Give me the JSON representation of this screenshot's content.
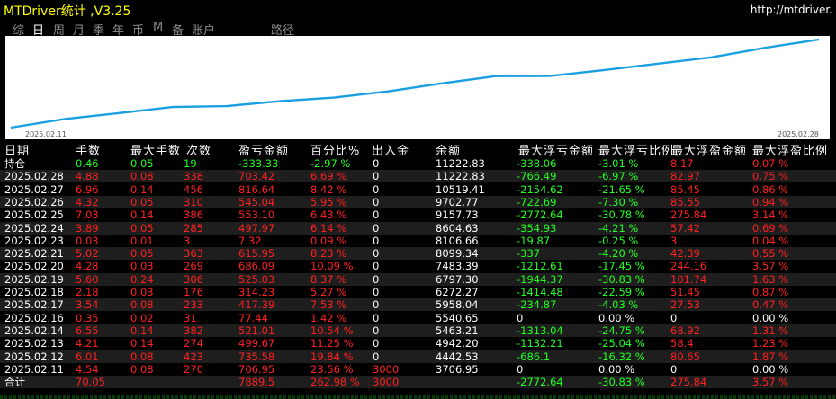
{
  "app": {
    "title": "MTDriver统计 ,V3.25",
    "url": "http://mtdriver."
  },
  "tabs": [
    {
      "label": "综",
      "active": false
    },
    {
      "label": "日",
      "active": true
    },
    {
      "label": "周",
      "active": false
    },
    {
      "label": "月",
      "active": false
    },
    {
      "label": "季",
      "active": false
    },
    {
      "label": "年",
      "active": false
    },
    {
      "label": "币",
      "active": false
    },
    {
      "label": "M",
      "active": false
    },
    {
      "label": "备",
      "active": false
    },
    {
      "label": "账户",
      "active": false
    },
    {
      "label": "路径",
      "active": false
    }
  ],
  "chart_data": {
    "type": "line",
    "x_start_label": "2025.02.11",
    "x_end_label": "2025.02.28",
    "x": [
      "2025.02.11",
      "2025.02.12",
      "2025.02.13",
      "2025.02.14",
      "2025.02.16",
      "2025.02.17",
      "2025.02.18",
      "2025.02.19",
      "2025.02.20",
      "2025.02.21",
      "2025.02.23",
      "2025.02.24",
      "2025.02.25",
      "2025.02.26",
      "2025.02.27",
      "2025.02.28"
    ],
    "values": [
      3706.95,
      4442.53,
      4942.2,
      5463.21,
      5540.65,
      5958.04,
      6272.27,
      6797.3,
      7483.39,
      8099.34,
      8106.66,
      8604.63,
      9157.73,
      9702.77,
      10519.41,
      11222.83
    ],
    "line_color": "#1a9fe0"
  },
  "headers": [
    "日期",
    "手数",
    "最大手数",
    "次数",
    "盈亏金额",
    "百分比%",
    "出入金",
    "余额",
    "最大浮亏金额",
    "最大浮亏比例",
    "最大浮盈金额",
    "最大浮盈比例"
  ],
  "rows": [
    {
      "date": "持仓",
      "lots": "0.46",
      "maxlots": "0.05",
      "count": "19",
      "pnl": "-333.33",
      "pct": "-2.97 %",
      "io": "0",
      "bal": "11222.83",
      "mfl": "-338.06",
      "mflp": "-3.01 %",
      "mfp": "8.17",
      "mfpp": "0.07 %",
      "tone": "green",
      "date_tone": "yellow"
    },
    {
      "date": "2025.02.28",
      "lots": "4.88",
      "maxlots": "0.08",
      "count": "338",
      "pnl": "703.42",
      "pct": "6.69 %",
      "io": "0",
      "bal": "11222.83",
      "mfl": "-766.49",
      "mflp": "-6.97 %",
      "mfp": "82.97",
      "mfpp": "0.75 %",
      "tone": "red"
    },
    {
      "date": "2025.02.27",
      "lots": "6.96",
      "maxlots": "0.14",
      "count": "456",
      "pnl": "816.64",
      "pct": "8.42 %",
      "io": "0",
      "bal": "10519.41",
      "mfl": "-2154.62",
      "mflp": "-21.65 %",
      "mfp": "85.45",
      "mfpp": "0.86 %",
      "tone": "red"
    },
    {
      "date": "2025.02.26",
      "lots": "4.32",
      "maxlots": "0.05",
      "count": "310",
      "pnl": "545.04",
      "pct": "5.95 %",
      "io": "0",
      "bal": "9702.77",
      "mfl": "-722.69",
      "mflp": "-7.30 %",
      "mfp": "85.55",
      "mfpp": "0.94 %",
      "tone": "red"
    },
    {
      "date": "2025.02.25",
      "lots": "7.03",
      "maxlots": "0.14",
      "count": "386",
      "pnl": "553.10",
      "pct": "6.43 %",
      "io": "0",
      "bal": "9157.73",
      "mfl": "-2772.64",
      "mflp": "-30.78 %",
      "mfp": "275.84",
      "mfpp": "3.14 %",
      "tone": "red"
    },
    {
      "date": "2025.02.24",
      "lots": "3.89",
      "maxlots": "0.05",
      "count": "285",
      "pnl": "497.97",
      "pct": "6.14 %",
      "io": "0",
      "bal": "8604.63",
      "mfl": "-354.93",
      "mflp": "-4.21 %",
      "mfp": "57.42",
      "mfpp": "0.69 %",
      "tone": "red"
    },
    {
      "date": "2025.02.23",
      "lots": "0.03",
      "maxlots": "0.01",
      "count": "3",
      "pnl": "7.32",
      "pct": "0.09 %",
      "io": "0",
      "bal": "8106.66",
      "mfl": "-19.87",
      "mflp": "-0.25 %",
      "mfp": "3",
      "mfpp": "0.04 %",
      "tone": "red"
    },
    {
      "date": "2025.02.21",
      "lots": "5.02",
      "maxlots": "0.05",
      "count": "363",
      "pnl": "615.95",
      "pct": "8.23 %",
      "io": "0",
      "bal": "8099.34",
      "mfl": "-337",
      "mflp": "-4.20 %",
      "mfp": "42.39",
      "mfpp": "0.55 %",
      "tone": "red"
    },
    {
      "date": "2025.02.20",
      "lots": "4.28",
      "maxlots": "0.03",
      "count": "269",
      "pnl": "686.09",
      "pct": "10.09 %",
      "io": "0",
      "bal": "7483.39",
      "mfl": "-1212.61",
      "mflp": "-17.45 %",
      "mfp": "244.16",
      "mfpp": "3.57 %",
      "tone": "red"
    },
    {
      "date": "2025.02.19",
      "lots": "5.60",
      "maxlots": "0.24",
      "count": "306",
      "pnl": "525.03",
      "pct": "8.37 %",
      "io": "0",
      "bal": "6797.30",
      "mfl": "-1944.37",
      "mflp": "-30.83 %",
      "mfp": "101.74",
      "mfpp": "1.63 %",
      "tone": "red"
    },
    {
      "date": "2025.02.18",
      "lots": "2.18",
      "maxlots": "0.03",
      "count": "176",
      "pnl": "314.23",
      "pct": "5.27 %",
      "io": "0",
      "bal": "6272.27",
      "mfl": "-1414.48",
      "mflp": "-22.59 %",
      "mfp": "51.45",
      "mfpp": "0.87 %",
      "tone": "red"
    },
    {
      "date": "2025.02.17",
      "lots": "3.54",
      "maxlots": "0.08",
      "count": "233",
      "pnl": "417.39",
      "pct": "7.53 %",
      "io": "0",
      "bal": "5958.04",
      "mfl": "-234.87",
      "mflp": "-4.03 %",
      "mfp": "27.53",
      "mfpp": "0.47 %",
      "tone": "red"
    },
    {
      "date": "2025.02.16",
      "lots": "0.35",
      "maxlots": "0.02",
      "count": "31",
      "pnl": "77.44",
      "pct": "1.42 %",
      "io": "0",
      "bal": "5540.65",
      "mfl": "0",
      "mflp": "0.00 %",
      "mfp": "0",
      "mfpp": "0.00 %",
      "tone": "red",
      "tail_white": true
    },
    {
      "date": "2025.02.14",
      "lots": "6.55",
      "maxlots": "0.14",
      "count": "382",
      "pnl": "521.01",
      "pct": "10.54 %",
      "io": "0",
      "bal": "5463.21",
      "mfl": "-1313.04",
      "mflp": "-24.75 %",
      "mfp": "68.92",
      "mfpp": "1.31 %",
      "tone": "red"
    },
    {
      "date": "2025.02.13",
      "lots": "4.21",
      "maxlots": "0.14",
      "count": "274",
      "pnl": "499.67",
      "pct": "11.25 %",
      "io": "0",
      "bal": "4942.20",
      "mfl": "-1132.21",
      "mflp": "-25.04 %",
      "mfp": "58.4",
      "mfpp": "1.23 %",
      "tone": "red"
    },
    {
      "date": "2025.02.12",
      "lots": "6.01",
      "maxlots": "0.08",
      "count": "423",
      "pnl": "735.58",
      "pct": "19.84 %",
      "io": "0",
      "bal": "4442.53",
      "mfl": "-686.1",
      "mflp": "-16.32 %",
      "mfp": "80.65",
      "mfpp": "1.87 %",
      "tone": "red"
    },
    {
      "date": "2025.02.11",
      "lots": "4.54",
      "maxlots": "0.08",
      "count": "270",
      "pnl": "706.95",
      "pct": "23.56 %",
      "io": "3000",
      "bal": "3706.95",
      "mfl": "0",
      "mflp": "0.00 %",
      "mfp": "0",
      "mfpp": "0.00 %",
      "tone": "red",
      "tail_white": true,
      "io_red": true
    },
    {
      "date": "合计",
      "lots": "70.05",
      "maxlots": "",
      "count": "",
      "pnl": "7889.5",
      "pct": "262.98 %",
      "io": "3000",
      "bal": "",
      "mfl": "-2772.64",
      "mflp": "-30.83 %",
      "mfp": "275.84",
      "mfpp": "3.57 %",
      "tone": "red",
      "date_tone": "yellow",
      "io_red": true
    }
  ]
}
